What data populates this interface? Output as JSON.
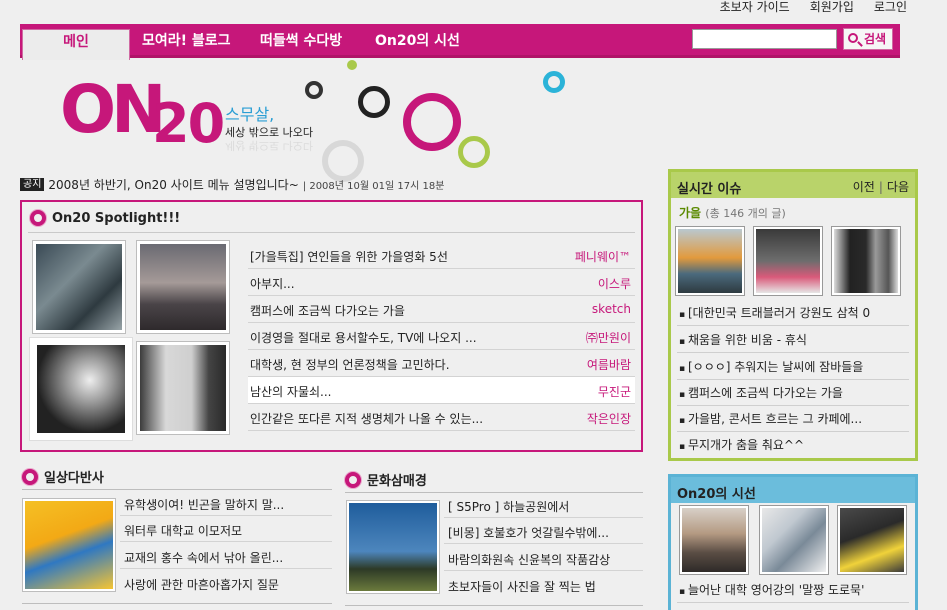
{
  "toplinks": [
    "초보자 가이드",
    "회원가입",
    "로그인"
  ],
  "nav": {
    "tabs": [
      "메인",
      "모여라! 블로그",
      "떠들썩 수다방",
      "On20의 시선"
    ],
    "search_label": "검색",
    "search_value": ""
  },
  "logo": {
    "brand": "ON20",
    "slogan_main": "스무살,",
    "slogan_sub": "세상 밖으로 나오다"
  },
  "notice": {
    "badge": "공지",
    "text": "2008년 하반기, On20 사이트 메뉴 설명입니다~",
    "date": "| 2008년 10월 01일 17시 18분"
  },
  "spotlight": {
    "title": "On20 Spotlight!!!",
    "items": [
      {
        "title": "[가을특집] 연인들을 위한 가을영화 5선",
        "author": "페니웨이™"
      },
      {
        "title": "아부지...",
        "author": "이스루"
      },
      {
        "title": "캠퍼스에 조금씩 다가오는 가을",
        "author": "sketch"
      },
      {
        "title": "이경영을 절대로 용서할수도, TV에 나오지 ...",
        "author": "㈜만원이"
      },
      {
        "title": "대학생, 현 정부의 언론정책을 고민하다.",
        "author": "여름바람"
      },
      {
        "title": "남산의 자물쇠...",
        "author": "무진군"
      },
      {
        "title": "인간같은 또다른 지적 생명체가 나올 수 있는...",
        "author": "작은인장"
      }
    ]
  },
  "daily": {
    "title": "일상다반사",
    "items": [
      "유학생이여! 빈곤을 말하지 말...",
      "워터루 대학교 이모저모",
      "교재의 홍수 속에서 낚아 올린...",
      "사랑에 관한 마흔아홉가지 질문"
    ]
  },
  "culture": {
    "title": "문화삼매경",
    "items": [
      "[ S5Pro ] 하늘공원에서",
      "[비몽] 호불호가 엇갈릴수밖에...",
      "바람의화원속 신윤복의 작품감상",
      "초보자들이 사진을 잘 찍는 법"
    ]
  },
  "issue": {
    "title": "실시간 이슈",
    "prev": "이전",
    "next": "다음",
    "keyword": "가을",
    "count": "(총 146 개의 글)",
    "items": [
      "[대한민국 트래블러거 강원도 삼척 0",
      "채움을 위한 비움 - 휴식",
      "[ㅇㅇㅇ] 추워지는 날씨에 잠바들을",
      "캠퍼스에 조금씩 다가오는 가을",
      "가을밤, 콘서트 흐르는 그 카페에...",
      "무지개가 춤을 춰요^^"
    ]
  },
  "view": {
    "title": "On20의 시선",
    "items": [
      "늘어난 대학 영어강의 '말짱 도로묵'"
    ]
  },
  "colors": {
    "brand": "#c6177a",
    "green": "#a9c94a",
    "blue": "#5bb3d5"
  }
}
